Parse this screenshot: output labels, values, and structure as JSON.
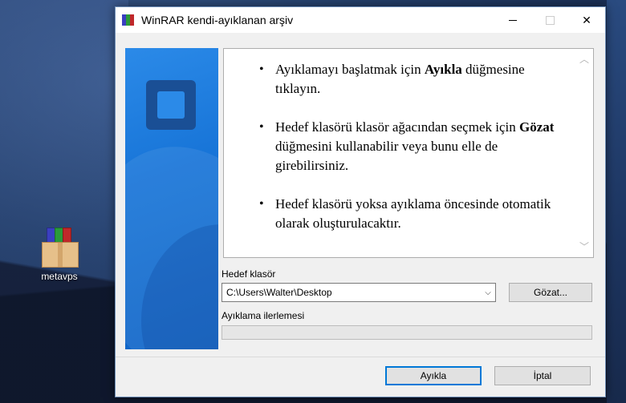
{
  "desktop": {
    "icon_label": "metavps"
  },
  "window": {
    "title": "WinRAR kendi-ayıklanan arşiv",
    "info": {
      "bullet1": {
        "pre": "Ayıklamayı başlatmak için ",
        "bold": "Ayıkla",
        "post": " düğmesine tıklayın."
      },
      "bullet2": {
        "pre": "Hedef klasörü klasör ağacından seçmek için ",
        "bold": "Gözat",
        "post": " düğmesini kullanabilir veya bunu elle de girebilirsiniz."
      },
      "bullet3": {
        "text": "Hedef klasörü yoksa ayıklama öncesinde otomatik olarak oluşturulacaktır."
      }
    },
    "dest_label": "Hedef klasör",
    "dest_value": "C:\\Users\\Walter\\Desktop",
    "browse_label": "Gözat...",
    "progress_label": "Ayıklama ilerlemesi",
    "progress_fraction": 0,
    "extract_label": "Ayıkla",
    "cancel_label": "İptal"
  },
  "colors": {
    "banner": "#1875d8",
    "accent": "#0078d7"
  }
}
